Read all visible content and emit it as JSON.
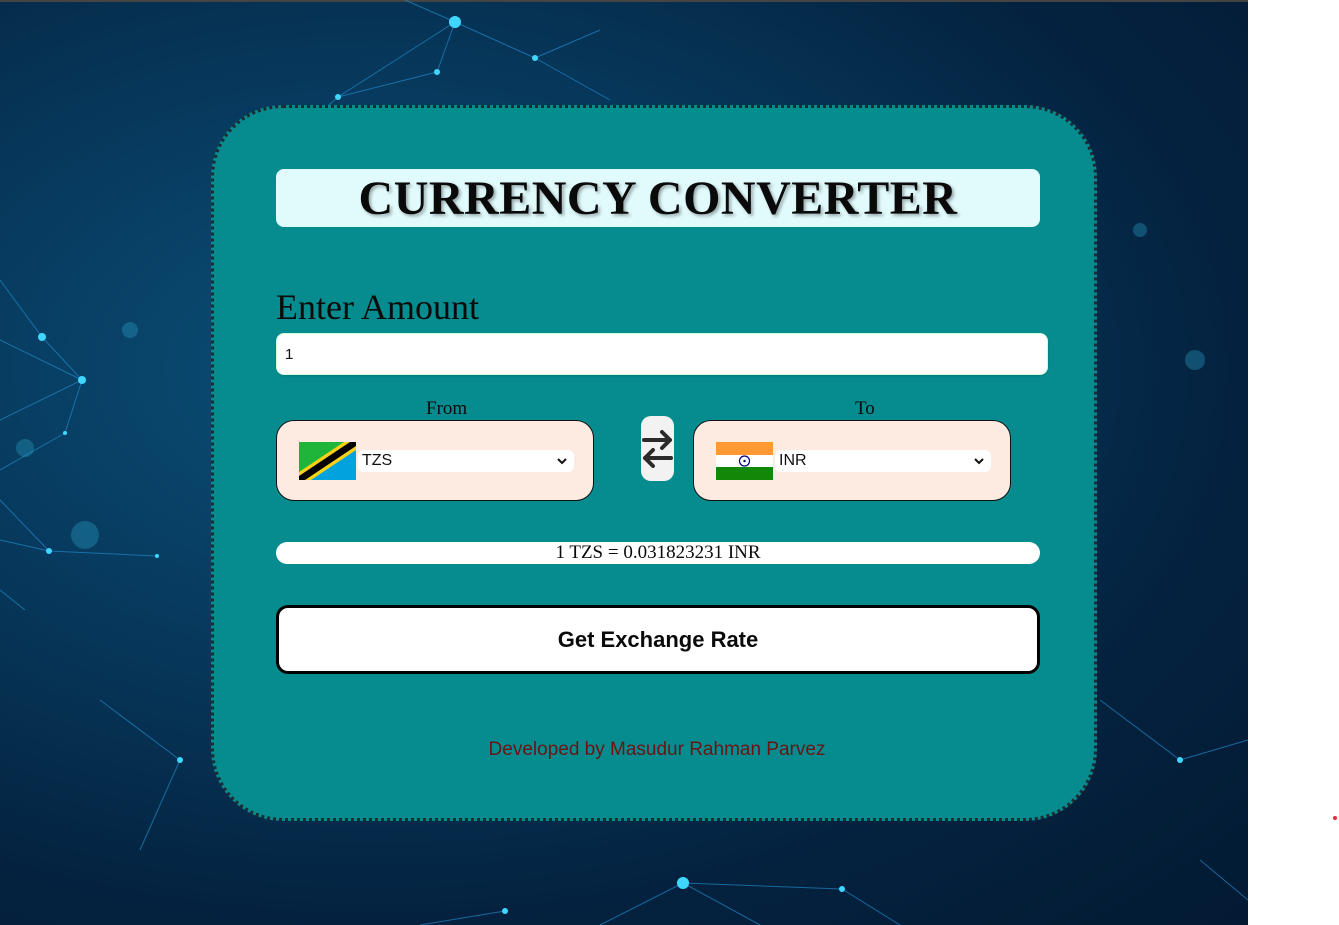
{
  "app": {
    "title": "CURRENCY CONVERTER"
  },
  "amount": {
    "label": "Enter Amount",
    "value": "1"
  },
  "from": {
    "label": "From",
    "currency": "TZS",
    "flag_icon": "tanzania-flag-icon"
  },
  "to": {
    "label": "To",
    "currency": "INR",
    "flag_icon": "india-flag-icon"
  },
  "swap": {
    "icon": "swap-arrows-icon"
  },
  "result": {
    "text": "1 TZS = 0.031823231 INR"
  },
  "button": {
    "label": "Get Exchange Rate"
  },
  "footer": {
    "text": "Developed by Masudur Rahman Parvez"
  },
  "colors": {
    "card": "#068c8f",
    "title_box": "#e1fbfd",
    "select_box": "#fdebe1",
    "footer_text": "#6b1414"
  }
}
